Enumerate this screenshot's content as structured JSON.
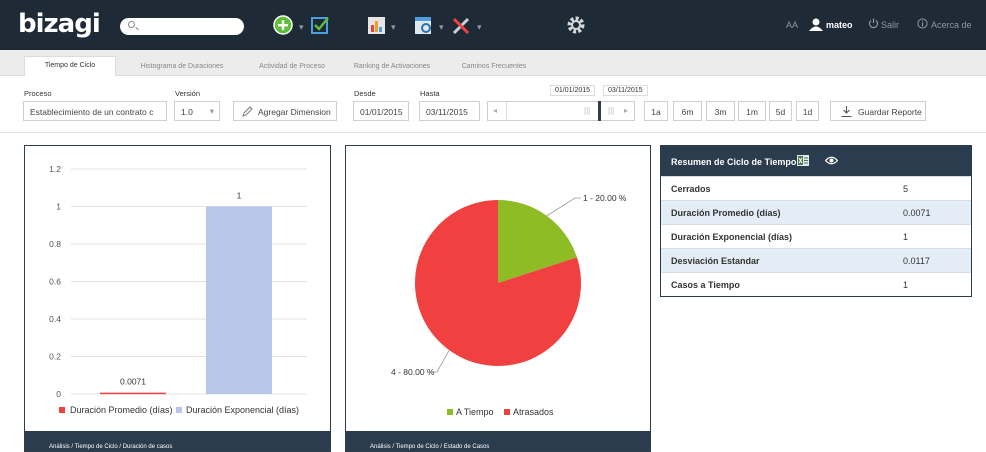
{
  "app": {
    "logo": "bizagi"
  },
  "header": {
    "font_size_label": "AA",
    "user": "mateo",
    "logout_label": "Salir",
    "about_label": "Acerca de"
  },
  "tabs": [
    {
      "label": "Tiempo de Ciclo",
      "active": true
    },
    {
      "label": "Histograma de Duraciones"
    },
    {
      "label": "Actividad de Proceso"
    },
    {
      "label": "Ranking de Activaciones"
    },
    {
      "label": "Caminos Frecuentes"
    }
  ],
  "filters": {
    "process_label": "Proceso",
    "process_value": "Establecimiento de un contrato c",
    "version_label": "Versión",
    "version_value": "1.0",
    "add_dimension_label": "Agregar Dimension",
    "from_label": "Desde",
    "from_value": "01/01/2015",
    "to_label": "Hasta",
    "to_value": "03/11/2015",
    "slider_start": "01/01/2015",
    "slider_end": "03/11/2015",
    "ranges": [
      "1a",
      "6m",
      "3m",
      "1m",
      "5d",
      "1d"
    ],
    "save_report_label": "Guardar Reporte"
  },
  "chart_data": [
    {
      "type": "bar",
      "categories": [
        "Duración Promedio (días)",
        "Duración Exponencial (días)"
      ],
      "values": [
        0.0071,
        1
      ],
      "data_labels": [
        "0.0071",
        "1"
      ],
      "colors": [
        "#f04040",
        "#b8c6e8"
      ],
      "ylim": [
        0,
        1.2
      ],
      "y_ticks": [
        "0",
        "0.2",
        "0.4",
        "0.6",
        "0.8",
        "1",
        "1.2"
      ],
      "grid": true,
      "legend_placement": "bottom",
      "footer": "Análisis / Tiempo de Ciclo / Duración de casos"
    },
    {
      "type": "pie",
      "slices": [
        {
          "name": "A Tiempo",
          "value": 1,
          "percent": 20.0,
          "label": "1 - 20.00 %",
          "color": "#8dbc24"
        },
        {
          "name": "Atrasados",
          "value": 4,
          "percent": 80.0,
          "label": "4 - 80.00 %",
          "color": "#f04040"
        }
      ],
      "legend_placement": "bottom",
      "footer": "Análisis / Tiempo de Ciclo / Estado de Casos"
    }
  ],
  "summary": {
    "title": "Resumen de Ciclo de Tiempo",
    "rows": [
      {
        "label": "Cerrados",
        "value": "5"
      },
      {
        "label": "Duración Promedio (días)",
        "value": "0.0071"
      },
      {
        "label": "Duración Exponencial (días)",
        "value": "1"
      },
      {
        "label": "Desviación Estandar",
        "value": "0.0117"
      },
      {
        "label": "Casos a Tiempo",
        "value": "1"
      }
    ]
  }
}
